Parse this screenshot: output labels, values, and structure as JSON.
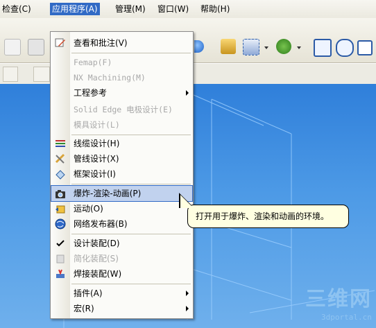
{
  "menubar": {
    "items": [
      "检查(C)",
      "应用程序(A)",
      "管理(M)",
      "窗口(W)",
      "帮助(H)"
    ],
    "active": "应用程序(A)"
  },
  "menu": {
    "items": [
      {
        "label": "查看和批注(V)",
        "icon": "annotate-icon",
        "enabled": true
      },
      {
        "label": "Femap(F)",
        "enabled": false
      },
      {
        "label": "NX Machining(M)",
        "enabled": false
      },
      {
        "label": "工程参考",
        "enabled": true,
        "submenu": true
      },
      {
        "label": "Solid Edge 电极设计(E)",
        "enabled": false
      },
      {
        "label": "模具设计(L)",
        "enabled": false
      },
      {
        "label": "线缆设计(H)",
        "icon": "wiring-icon",
        "enabled": true
      },
      {
        "label": "管线设计(X)",
        "icon": "piping-icon",
        "enabled": true
      },
      {
        "label": "框架设计(I)",
        "icon": "frame-icon",
        "enabled": true
      },
      {
        "label": "爆炸-渲染-动画(P)",
        "icon": "camera-icon",
        "enabled": true,
        "highlighted": true
      },
      {
        "label": "运动(O)",
        "icon": "motion-icon",
        "enabled": true
      },
      {
        "label": "网络发布器(B)",
        "icon": "globe-icon",
        "enabled": true
      },
      {
        "label": "设计装配(D)",
        "icon": "checkmark-icon",
        "enabled": true,
        "checked": true
      },
      {
        "label": "简化装配(S)",
        "icon": "simplify-icon",
        "enabled": false
      },
      {
        "label": "焊接装配(W)",
        "icon": "weld-icon",
        "enabled": true
      },
      {
        "label": "插件(A)",
        "enabled": true,
        "submenu": true
      },
      {
        "label": "宏(R)",
        "enabled": true,
        "submenu": true
      }
    ]
  },
  "tooltip": {
    "text": "打开用于爆炸、渲染和动画的环境。"
  },
  "watermark": {
    "text": "三维网",
    "subtext": "3dportal.cn"
  },
  "colors": {
    "highlight": "#c1d2ee",
    "menu_active": "#316ac5",
    "canvas": "#4d9ae6",
    "tooltip_bg": "#ffffe1"
  }
}
